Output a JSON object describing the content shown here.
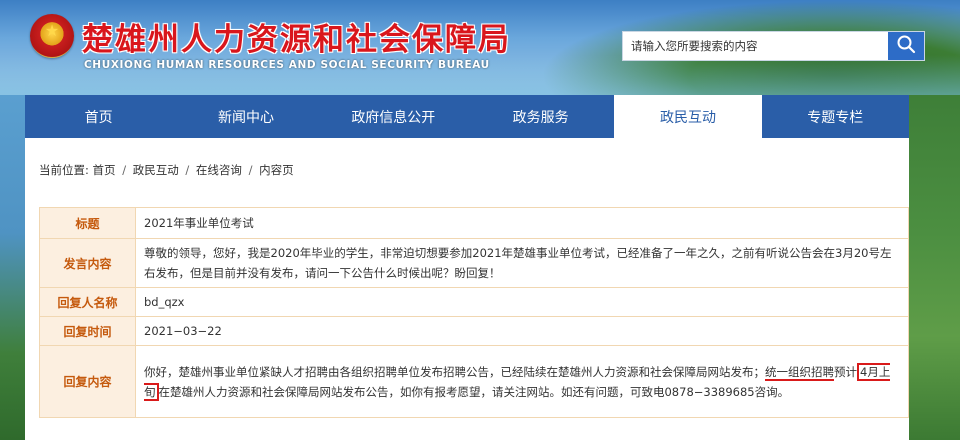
{
  "header": {
    "title": "楚雄州人力资源和社会保障局",
    "subtitle": "CHUXIONG HUMAN RESOURCES AND SOCIAL SECURITY BUREAU",
    "emblem_icon": "national-emblem-icon"
  },
  "search": {
    "placeholder": "请输入您所要搜索的内容",
    "button_icon": "search-icon"
  },
  "nav": {
    "items": [
      {
        "label": "首页"
      },
      {
        "label": "新闻中心"
      },
      {
        "label": "政府信息公开"
      },
      {
        "label": "政务服务"
      },
      {
        "label": "政民互动",
        "active": true
      },
      {
        "label": "专题专栏"
      }
    ]
  },
  "breadcrumb": {
    "prefix": "当前位置:",
    "items": [
      "首页",
      "政民互动",
      "在线咨询",
      "内容页"
    ],
    "separator": "/"
  },
  "detail": {
    "title_label": "标题",
    "title_value": "2021年事业单位考试",
    "content_label": "发言内容",
    "content_value": "尊敬的领导，您好，我是2020年毕业的学生，非常迫切想要参加2021年楚雄事业单位考试，已经准备了一年之久，之前有听说公告会在3月20号左右发布，但是目前并没有发布，请问一下公告什么时候出呢？盼回复！",
    "replier_label": "回复人名称",
    "replier_value": "bd_qzx",
    "reply_time_label": "回复时间",
    "reply_time_value": "2021−03−22",
    "reply_content_label": "回复内容",
    "reply_part1": "你好，楚雄州事业单位紧缺人才招聘由各组织招聘单位发布招聘公告，已经陆续在楚雄州人力资源和社会保障局网站发布；",
    "reply_underlined": "统一组织招聘",
    "reply_part2": "预计",
    "reply_boxed": "4月上旬",
    "reply_part3": "在楚雄州人力资源和社会保障局网站发布公告，如你有报考愿望，请关注网站。如还有问题，可致电0878−3389685咨询。"
  },
  "colors": {
    "nav_bg": "#2a5ea8",
    "title_red": "#d9161c",
    "label_orange": "#c55a0e",
    "label_bg": "#fcefe0",
    "annotation_red": "#d91a1a"
  }
}
